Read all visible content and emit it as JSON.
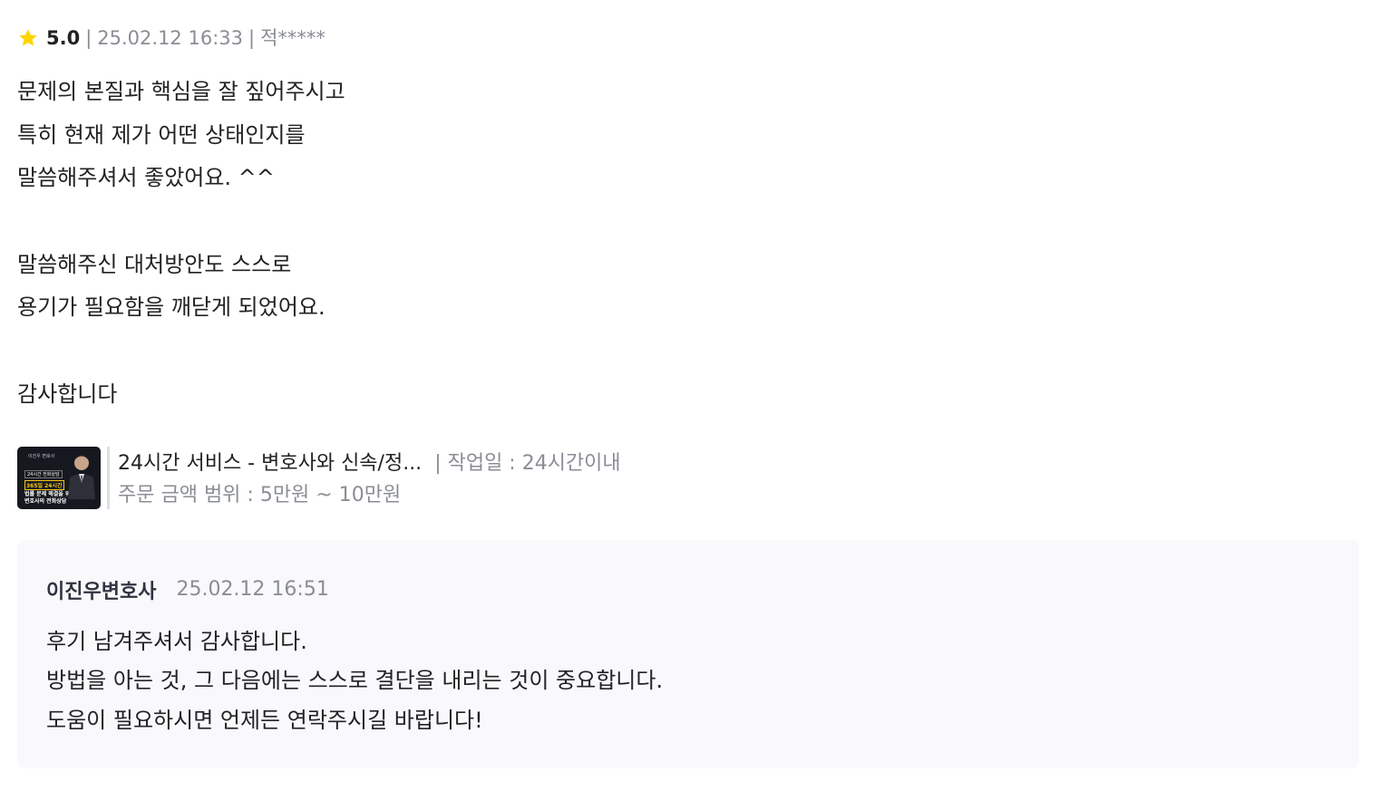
{
  "review": {
    "rating": "5.0",
    "separator": "|",
    "date": "25.02.12 16:33",
    "author": "적*****",
    "star_icon": "star-icon",
    "star_color": "#ffd400",
    "body_lines": [
      "문제의 본질과 핵심을 잘 짚어주시고",
      "특히 현재 제가 어떤 상태인지를",
      "말씀해주셔서 좋았어요. ^^",
      "",
      "말씀해주신 대처방안도 스스로",
      "용기가 필요함을 깨닫게 되었어요.",
      "",
      "감사합니다"
    ]
  },
  "product": {
    "thumbnail": {
      "brand": "이진우 변호사",
      "tag": "24시간 전화상담",
      "highlight": "365일 24시간",
      "line1": "법률 문제 해결을 위한",
      "line2": "변호사의 전화상담"
    },
    "title": "24시간 서비스 - 변호사와 신속/정...",
    "workday": "| 작업일 : 24시간이내",
    "price_range": "주문 금액 범위 : 5만원 ~ 10만원"
  },
  "reply": {
    "name": "이진우변호사",
    "date": "25.02.12 16:51",
    "body_lines": [
      "후기 남겨주셔서 감사합니다.",
      "방법을 아는 것, 그 다음에는 스스로 결단을 내리는 것이 중요합니다.",
      "도움이 필요하시면 언제든 연락주시길 바랍니다!"
    ]
  }
}
